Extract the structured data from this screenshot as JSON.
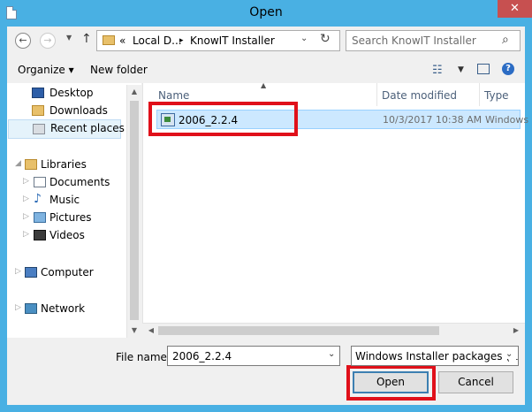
{
  "window": {
    "title": "Open",
    "close_label": "✕"
  },
  "address": {
    "prefix": "«",
    "crumbs": [
      "Local D...",
      "KnowIT Installer"
    ],
    "separator": "▸"
  },
  "search": {
    "placeholder": "Search KnowIT Installer"
  },
  "toolbar": {
    "organize_label": "Organize ▾",
    "new_folder_label": "New folder"
  },
  "nav": {
    "favorites": [
      {
        "label": "Desktop"
      },
      {
        "label": "Downloads"
      },
      {
        "label": "Recent places",
        "selected": true
      }
    ],
    "libraries_label": "Libraries",
    "libraries": [
      {
        "label": "Documents"
      },
      {
        "label": "Music"
      },
      {
        "label": "Pictures"
      },
      {
        "label": "Videos"
      }
    ],
    "computer_label": "Computer",
    "network_label": "Network"
  },
  "columns": {
    "name": "Name",
    "date_modified": "Date modified",
    "type": "Type"
  },
  "files": [
    {
      "name": "2006_2.2.4",
      "date_modified": "10/3/2017 10:38 AM",
      "type": "Windows",
      "selected": true
    }
  ],
  "bottom": {
    "file_name_label": "File name:",
    "file_name_value": "2006_2.2.4",
    "file_type_value": "Windows Installer packages (*.r",
    "open_label": "Open",
    "cancel_label": "Cancel"
  },
  "colors": {
    "title_bar": "#49b0e3",
    "highlight": "#e0101a",
    "selection": "#cce8ff"
  }
}
